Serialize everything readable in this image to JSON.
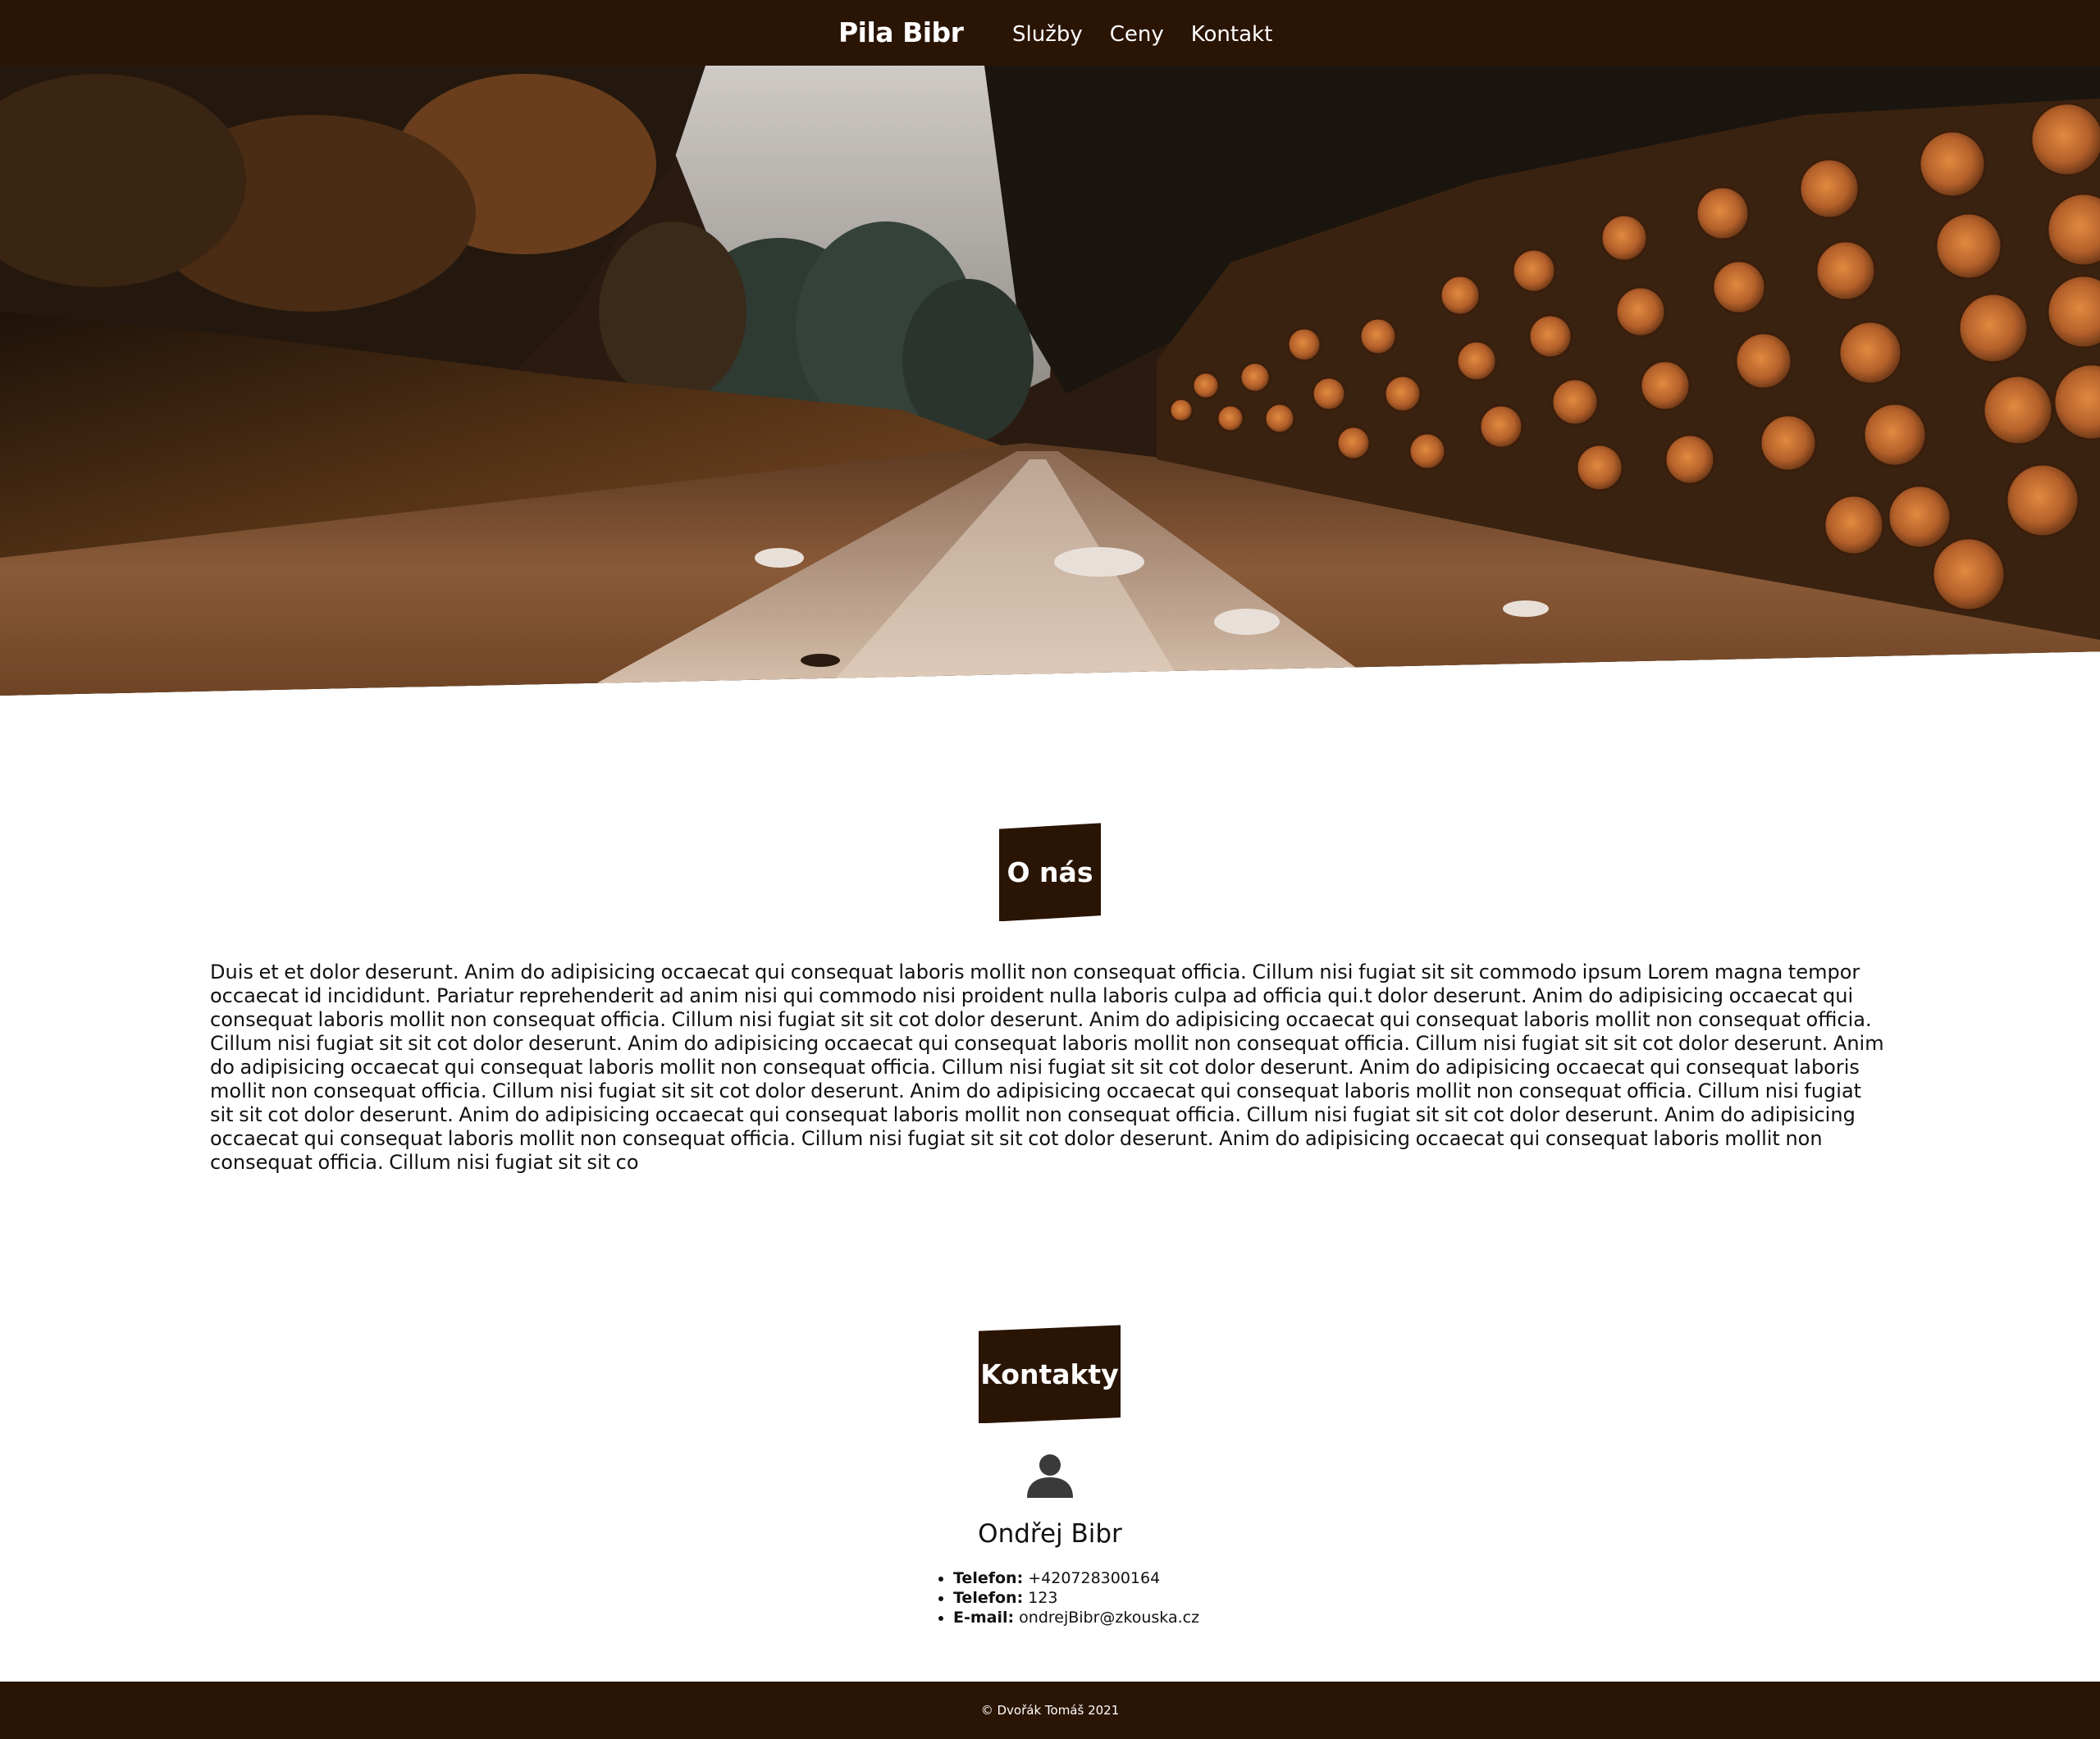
{
  "nav": {
    "brand": "Pila Bibr",
    "links": [
      {
        "label": "Služby"
      },
      {
        "label": "Ceny"
      },
      {
        "label": "Kontakt"
      }
    ]
  },
  "hero": {
    "image_icon": "forest-road-with-stacked-logs-photo"
  },
  "about": {
    "title": "O nás",
    "text": "Duis et et dolor deserunt. Anim do adipisicing occaecat qui consequat laboris mollit non consequat officia. Cillum nisi fugiat sit sit commodo ipsum Lorem magna tempor occaecat id incididunt. Pariatur reprehenderit ad anim nisi qui commodo nisi proident nulla laboris culpa ad officia qui.t dolor deserunt. Anim do adipisicing occaecat qui consequat laboris mollit non consequat officia. Cillum nisi fugiat sit sit cot dolor deserunt. Anim do adipisicing occaecat qui consequat laboris mollit non consequat officia. Cillum nisi fugiat sit sit cot dolor deserunt. Anim do adipisicing occaecat qui consequat laboris mollit non consequat officia. Cillum nisi fugiat sit sit cot dolor deserunt. Anim do adipisicing occaecat qui consequat laboris mollit non consequat officia. Cillum nisi fugiat sit sit cot dolor deserunt. Anim do adipisicing occaecat qui consequat laboris mollit non consequat officia. Cillum nisi fugiat sit sit cot dolor deserunt. Anim do adipisicing occaecat qui consequat laboris mollit non consequat officia. Cillum nisi fugiat sit sit cot dolor deserunt. Anim do adipisicing occaecat qui consequat laboris mollit non consequat officia. Cillum nisi fugiat sit sit cot dolor deserunt. Anim do adipisicing occaecat qui consequat laboris mollit non consequat officia. Cillum nisi fugiat sit sit cot dolor deserunt. Anim do adipisicing occaecat qui consequat laboris mollit non consequat officia. Cillum nisi fugiat sit sit co"
  },
  "contacts": {
    "title": "Kontakty",
    "person_icon": "user-icon",
    "name": "Ondřej Bibr",
    "items": [
      {
        "label": "Telefon:",
        "value": "+420728300164"
      },
      {
        "label": "Telefon:",
        "value": "123"
      },
      {
        "label": "E-mail:",
        "value": "ondrejBibr@zkouska.cz"
      }
    ]
  },
  "footer": {
    "text": "© Dvořák Tomáš 2021"
  },
  "colors": {
    "brand_dark": "#2a1404",
    "text": "#111111",
    "background": "#ffffff"
  }
}
